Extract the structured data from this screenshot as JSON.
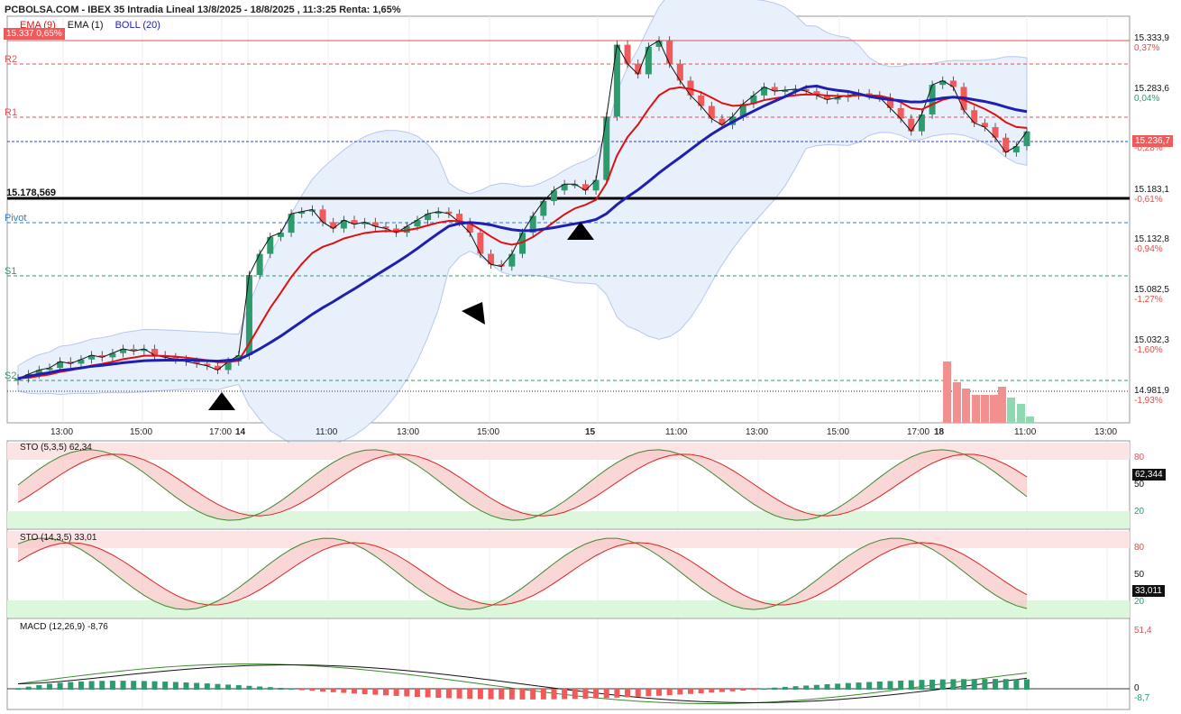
{
  "header": {
    "title": "PCBOLSA.COM - IBEX 35 Intradia Lineal 13/8/2025 - 18/8/2025 , 11:3:25 Renta: 1,65%"
  },
  "legend": {
    "ema9": "EMA (9)",
    "ema1": "EMA (1)",
    "boll": "BOLL (20)"
  },
  "price_box": "15.337  0,65%",
  "levels": {
    "r2": "R2",
    "r1": "R1",
    "pivot": "Pivot",
    "s1": "S1",
    "s2": "S2"
  },
  "marked_level": "15.178,569",
  "right_axis": [
    {
      "price": "15.333,9",
      "pct": "0,37%"
    },
    {
      "price": "15.283,6",
      "pct": "0,04%"
    },
    {
      "price": "",
      "pct": "-0,28%"
    },
    {
      "price": "15.183,1",
      "pct": "-0,61%"
    },
    {
      "price": "15.132,8",
      "pct": "-0,94%"
    },
    {
      "price": "15.082,5",
      "pct": "-1,27%"
    },
    {
      "price": "15.032,3",
      "pct": "-1,60%"
    },
    {
      "price": "14.981,9",
      "pct": "-1,93%"
    }
  ],
  "current_price_label": "15.236,7",
  "x_labels": [
    "13:00",
    "15:00",
    "17:00",
    "14",
    "11:00",
    "13:00",
    "15:00",
    "15",
    "11:00",
    "13:00",
    "15:00",
    "17:00",
    "18",
    "11:00",
    "13:00"
  ],
  "panels": {
    "sto1": {
      "label": "STO (5,3,5)  62,34",
      "value": "62,344",
      "ticks": [
        "80",
        "50",
        "20"
      ]
    },
    "sto2": {
      "label": "STO (14,3,5)  33,01",
      "value": "33,011",
      "ticks": [
        "80",
        "50",
        "20"
      ]
    },
    "macd": {
      "label": "MACD (12,26,9)  -8,76",
      "ticks": [
        "51,4",
        "0",
        "-8,7"
      ]
    }
  },
  "colors": {
    "up": "#2e9b6e",
    "down": "#f05a5a",
    "ema9": "#e01010",
    "boll_mid": "#2020b0",
    "band_fill": "#e8f0fc"
  },
  "chart_data": {
    "type": "candlestick",
    "title": "IBEX 35 Intradia Lineal 13/8/2025 - 18/8/2025",
    "ylim": [
      14960,
      15345
    ],
    "close": [
      15002,
      15006,
      15010,
      15012,
      15018,
      15016,
      15020,
      15024,
      15022,
      15026,
      15030,
      15028,
      15030,
      15024,
      15022,
      15020,
      15018,
      15016,
      15014,
      15010,
      15018,
      15024,
      15100,
      15120,
      15136,
      15140,
      15158,
      15160,
      15162,
      15150,
      15144,
      15152,
      15148,
      15150,
      15146,
      15144,
      15140,
      15146,
      15152,
      15158,
      15160,
      15158,
      15150,
      15140,
      15120,
      15110,
      15108,
      15120,
      15140,
      15156,
      15170,
      15180,
      15186,
      15186,
      15180,
      15190,
      15250,
      15318,
      15300,
      15290,
      15316,
      15322,
      15300,
      15284,
      15270,
      15260,
      15248,
      15242,
      15250,
      15262,
      15270,
      15278,
      15274,
      15275,
      15276,
      15274,
      15270,
      15266,
      15268,
      15270,
      15272,
      15270,
      15268,
      15258,
      15248,
      15236,
      15252,
      15280,
      15284,
      15278,
      15256,
      15244,
      15240,
      15230,
      15216,
      15222,
      15236
    ]
  }
}
